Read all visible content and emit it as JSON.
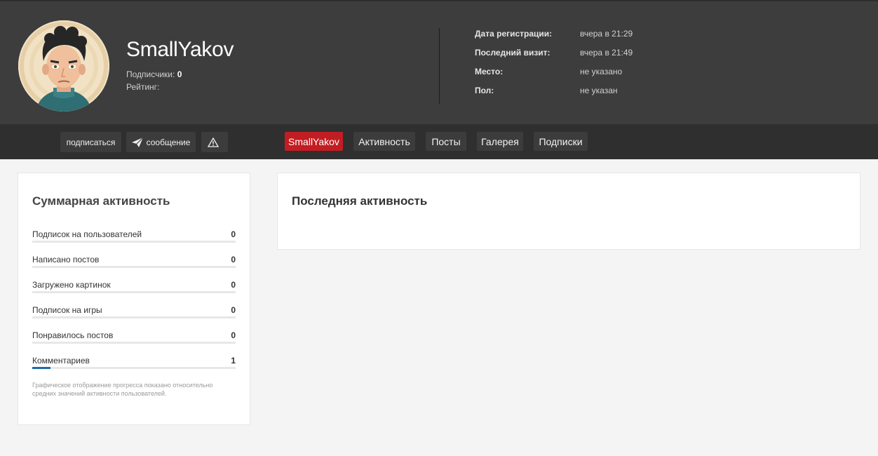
{
  "profile": {
    "username": "SmallYakov",
    "subscribers_label": "Подписчики:",
    "subscribers_count": "0",
    "rating_label": "Рейтинг:"
  },
  "info": [
    {
      "label": "Дата регистрации:",
      "value": "вчера в 21:29"
    },
    {
      "label": "Последний визит:",
      "value": "вчера в 21:49"
    },
    {
      "label": "Место:",
      "value": "не указано"
    },
    {
      "label": "Пол:",
      "value": "не указан"
    }
  ],
  "actions": {
    "subscribe": "подписаться",
    "message": "сообщение",
    "report_icon": "warning-icon"
  },
  "tabs": [
    {
      "label": "SmallYakov",
      "active": true
    },
    {
      "label": "Активность",
      "active": false
    },
    {
      "label": "Посты",
      "active": false
    },
    {
      "label": "Галерея",
      "active": false
    },
    {
      "label": "Подписки",
      "active": false
    }
  ],
  "summary": {
    "title": "Суммарная активность",
    "stats": [
      {
        "label": "Подписок на пользователей",
        "value": "0",
        "progress": 0
      },
      {
        "label": "Написано постов",
        "value": "0",
        "progress": 0
      },
      {
        "label": "Загружено картинок",
        "value": "0",
        "progress": 0
      },
      {
        "label": "Подписок на игры",
        "value": "0",
        "progress": 0
      },
      {
        "label": "Понравилось постов",
        "value": "0",
        "progress": 0
      },
      {
        "label": "Комментариев",
        "value": "1",
        "progress": 0.09
      }
    ],
    "note": "Графическое отображение прогресса показано относительно средних значений активности пользователей."
  },
  "recent": {
    "title": "Последняя активность"
  },
  "colors": {
    "header_bg": "#3d3d3d",
    "navbar_bg": "#2f2f2f",
    "active_tab": "#c21d22",
    "progress": "#1f6bb0"
  }
}
